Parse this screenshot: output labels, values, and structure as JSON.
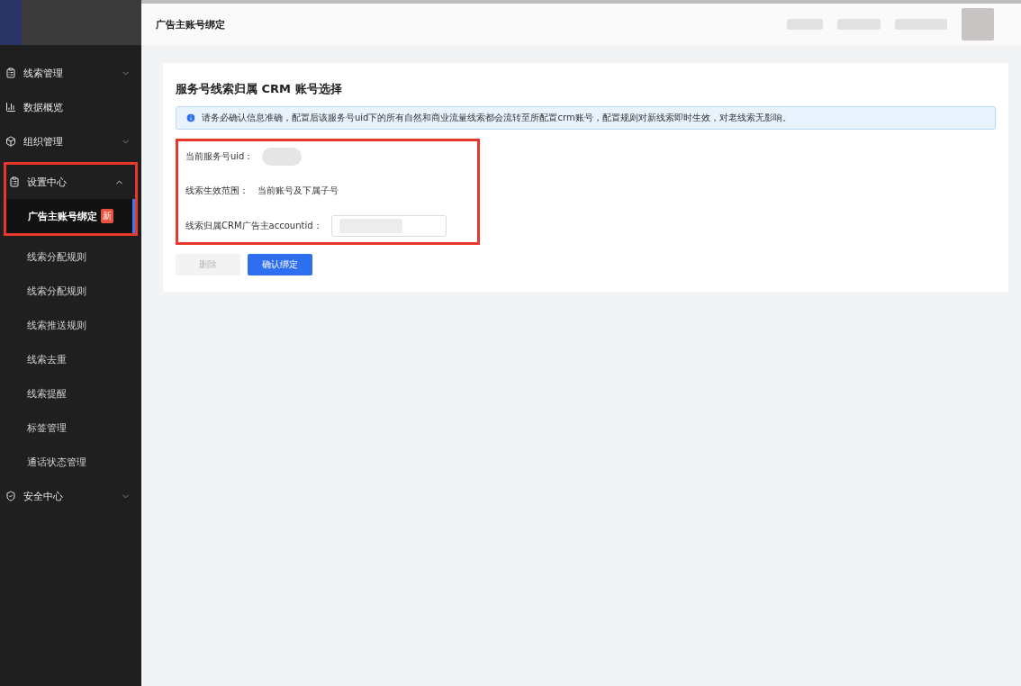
{
  "sidebar": {
    "items": [
      {
        "label": "线索管理",
        "expanded": false,
        "highlighted": false
      },
      {
        "label": "数据概览",
        "highlighted": false
      },
      {
        "label": "组织管理",
        "expanded": false,
        "highlighted": false
      },
      {
        "label": "设置中心",
        "expanded": true,
        "highlighted": true,
        "children": [
          {
            "label": "广告主账号绑定",
            "selected": true,
            "badge": "新"
          },
          {
            "label": "线索分配规则",
            "selected": false
          },
          {
            "label": "线索分配规则",
            "selected": false
          },
          {
            "label": "线索推送规则",
            "selected": false
          },
          {
            "label": "线索去重",
            "selected": false
          },
          {
            "label": "线索提醒",
            "selected": false
          },
          {
            "label": "标签管理",
            "selected": false
          },
          {
            "label": "通话状态管理",
            "selected": false
          }
        ]
      },
      {
        "label": "安全中心",
        "expanded": false,
        "highlighted": false
      }
    ]
  },
  "header": {
    "title": "广告主账号绑定"
  },
  "card": {
    "title": "服务号线索归属 CRM 账号选择",
    "notice": "请务必确认信息准确，配置后该服务号uid下的所有自然和商业流量线索都会流转至所配置crm账号，配置规则对新线索即时生效，对老线索无影响。",
    "highlighted": true,
    "fields": [
      {
        "kind": "redacted",
        "label": "当前服务号uid："
      },
      {
        "kind": "text",
        "label": "线索生效范围：",
        "value": "当前账号及下属子号"
      },
      {
        "kind": "input",
        "label": "线索归属CRM广告主accountid："
      }
    ],
    "buttons": [
      {
        "label": "删除",
        "kind": "default",
        "disabled": true
      },
      {
        "label": "确认绑定",
        "kind": "primary",
        "disabled": false
      }
    ]
  }
}
